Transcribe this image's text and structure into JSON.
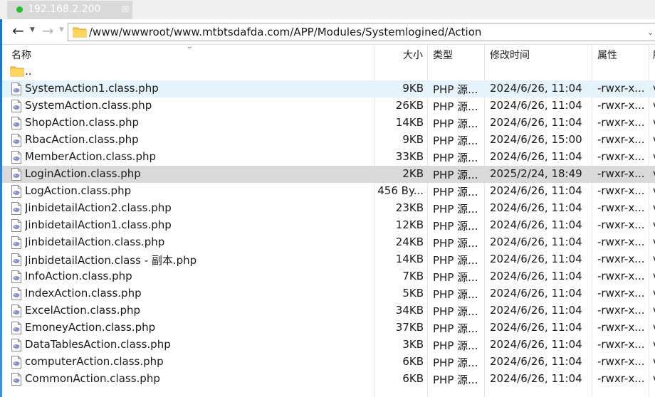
{
  "tab": {
    "title": "192.168.2.200",
    "close": "⊠"
  },
  "address": {
    "path": "/www/wwwroot/www.mtbtsdafda.com/APP/Modules/Systemlogined/Action"
  },
  "columns": {
    "name": "名称",
    "size": "大小",
    "type": "类型",
    "modified": "修改时间",
    "attrs": "属性",
    "extra": "所"
  },
  "colors": {
    "accent": "#1a74d8",
    "hover": "#e5f3fd",
    "selected": "#d9d9d9",
    "tab_dot": "#1ec22a"
  },
  "parent": {
    "name": ".."
  },
  "files": [
    {
      "name": "SystemAction1.class.php",
      "size": "9KB",
      "type": "PHP 源...",
      "modified": "2024/6/26, 11:04",
      "perm": "-rwxr-x...",
      "extra": "v",
      "state": "hover"
    },
    {
      "name": "SystemAction.class.php",
      "size": "26KB",
      "type": "PHP 源...",
      "modified": "2024/6/26, 11:04",
      "perm": "-rwxr-x...",
      "extra": "v",
      "state": ""
    },
    {
      "name": "ShopAction.class.php",
      "size": "14KB",
      "type": "PHP 源...",
      "modified": "2024/6/26, 11:04",
      "perm": "-rwxr-x...",
      "extra": "v",
      "state": ""
    },
    {
      "name": "RbacAction.class.php",
      "size": "9KB",
      "type": "PHP 源...",
      "modified": "2024/6/26, 15:00",
      "perm": "-rwxr-x...",
      "extra": "v",
      "state": ""
    },
    {
      "name": "MemberAction.class.php",
      "size": "33KB",
      "type": "PHP 源...",
      "modified": "2024/6/26, 11:04",
      "perm": "-rwxr-x...",
      "extra": "v",
      "state": ""
    },
    {
      "name": "LoginAction.class.php",
      "size": "2KB",
      "type": "PHP 源...",
      "modified": "2025/2/24, 18:49",
      "perm": "-rwxr-x...",
      "extra": "v",
      "state": "selected"
    },
    {
      "name": "LogAction.class.php",
      "size": "456 By...",
      "type": "PHP 源...",
      "modified": "2024/6/26, 11:04",
      "perm": "-rwxr-x...",
      "extra": "v",
      "state": ""
    },
    {
      "name": "JinbidetailAction2.class.php",
      "size": "23KB",
      "type": "PHP 源...",
      "modified": "2024/6/26, 11:04",
      "perm": "-rwxr-x...",
      "extra": "v",
      "state": ""
    },
    {
      "name": "JinbidetailAction1.class.php",
      "size": "12KB",
      "type": "PHP 源...",
      "modified": "2024/6/26, 11:04",
      "perm": "-rwxr-x...",
      "extra": "v",
      "state": ""
    },
    {
      "name": "JinbidetailAction.class.php",
      "size": "24KB",
      "type": "PHP 源...",
      "modified": "2024/6/26, 11:04",
      "perm": "-rwxr-x...",
      "extra": "v",
      "state": ""
    },
    {
      "name": "JinbidetailAction.class - 副本.php",
      "size": "14KB",
      "type": "PHP 源...",
      "modified": "2024/6/26, 11:04",
      "perm": "-rwxr-x...",
      "extra": "v",
      "state": ""
    },
    {
      "name": "InfoAction.class.php",
      "size": "7KB",
      "type": "PHP 源...",
      "modified": "2024/6/26, 11:04",
      "perm": "-rwxr-x...",
      "extra": "v",
      "state": ""
    },
    {
      "name": "IndexAction.class.php",
      "size": "5KB",
      "type": "PHP 源...",
      "modified": "2024/6/26, 11:04",
      "perm": "-rwxr-x...",
      "extra": "v",
      "state": ""
    },
    {
      "name": "ExcelAction.class.php",
      "size": "34KB",
      "type": "PHP 源...",
      "modified": "2024/6/26, 11:04",
      "perm": "-rwxr-x...",
      "extra": "v",
      "state": ""
    },
    {
      "name": "EmoneyAction.class.php",
      "size": "37KB",
      "type": "PHP 源...",
      "modified": "2024/6/26, 11:04",
      "perm": "-rwxr-x...",
      "extra": "v",
      "state": ""
    },
    {
      "name": "DataTablesAction.class.php",
      "size": "3KB",
      "type": "PHP 源...",
      "modified": "2024/6/26, 11:04",
      "perm": "-rwxr-x...",
      "extra": "v",
      "state": ""
    },
    {
      "name": "computerAction.class.php",
      "size": "6KB",
      "type": "PHP 源...",
      "modified": "2024/6/26, 11:04",
      "perm": "-rwxr-x...",
      "extra": "v",
      "state": ""
    },
    {
      "name": "CommonAction.class.php",
      "size": "6KB",
      "type": "PHP 源...",
      "modified": "2024/6/26, 11:04",
      "perm": "-rwxr-x...",
      "extra": "v",
      "state": ""
    }
  ]
}
